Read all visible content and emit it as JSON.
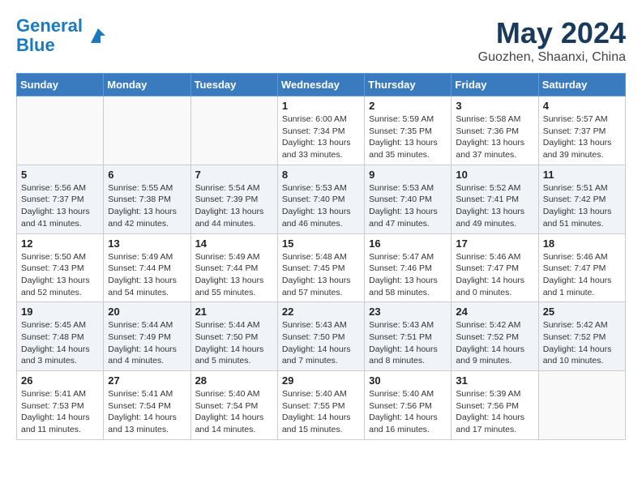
{
  "header": {
    "logo_line1": "General",
    "logo_line2": "Blue",
    "month": "May 2024",
    "location": "Guozhen, Shaanxi, China"
  },
  "weekdays": [
    "Sunday",
    "Monday",
    "Tuesday",
    "Wednesday",
    "Thursday",
    "Friday",
    "Saturday"
  ],
  "weeks": [
    [
      {
        "day": "",
        "info": ""
      },
      {
        "day": "",
        "info": ""
      },
      {
        "day": "",
        "info": ""
      },
      {
        "day": "1",
        "info": "Sunrise: 6:00 AM\nSunset: 7:34 PM\nDaylight: 13 hours\nand 33 minutes."
      },
      {
        "day": "2",
        "info": "Sunrise: 5:59 AM\nSunset: 7:35 PM\nDaylight: 13 hours\nand 35 minutes."
      },
      {
        "day": "3",
        "info": "Sunrise: 5:58 AM\nSunset: 7:36 PM\nDaylight: 13 hours\nand 37 minutes."
      },
      {
        "day": "4",
        "info": "Sunrise: 5:57 AM\nSunset: 7:37 PM\nDaylight: 13 hours\nand 39 minutes."
      }
    ],
    [
      {
        "day": "5",
        "info": "Sunrise: 5:56 AM\nSunset: 7:37 PM\nDaylight: 13 hours\nand 41 minutes."
      },
      {
        "day": "6",
        "info": "Sunrise: 5:55 AM\nSunset: 7:38 PM\nDaylight: 13 hours\nand 42 minutes."
      },
      {
        "day": "7",
        "info": "Sunrise: 5:54 AM\nSunset: 7:39 PM\nDaylight: 13 hours\nand 44 minutes."
      },
      {
        "day": "8",
        "info": "Sunrise: 5:53 AM\nSunset: 7:40 PM\nDaylight: 13 hours\nand 46 minutes."
      },
      {
        "day": "9",
        "info": "Sunrise: 5:53 AM\nSunset: 7:40 PM\nDaylight: 13 hours\nand 47 minutes."
      },
      {
        "day": "10",
        "info": "Sunrise: 5:52 AM\nSunset: 7:41 PM\nDaylight: 13 hours\nand 49 minutes."
      },
      {
        "day": "11",
        "info": "Sunrise: 5:51 AM\nSunset: 7:42 PM\nDaylight: 13 hours\nand 51 minutes."
      }
    ],
    [
      {
        "day": "12",
        "info": "Sunrise: 5:50 AM\nSunset: 7:43 PM\nDaylight: 13 hours\nand 52 minutes."
      },
      {
        "day": "13",
        "info": "Sunrise: 5:49 AM\nSunset: 7:44 PM\nDaylight: 13 hours\nand 54 minutes."
      },
      {
        "day": "14",
        "info": "Sunrise: 5:49 AM\nSunset: 7:44 PM\nDaylight: 13 hours\nand 55 minutes."
      },
      {
        "day": "15",
        "info": "Sunrise: 5:48 AM\nSunset: 7:45 PM\nDaylight: 13 hours\nand 57 minutes."
      },
      {
        "day": "16",
        "info": "Sunrise: 5:47 AM\nSunset: 7:46 PM\nDaylight: 13 hours\nand 58 minutes."
      },
      {
        "day": "17",
        "info": "Sunrise: 5:46 AM\nSunset: 7:47 PM\nDaylight: 14 hours\nand 0 minutes."
      },
      {
        "day": "18",
        "info": "Sunrise: 5:46 AM\nSunset: 7:47 PM\nDaylight: 14 hours\nand 1 minute."
      }
    ],
    [
      {
        "day": "19",
        "info": "Sunrise: 5:45 AM\nSunset: 7:48 PM\nDaylight: 14 hours\nand 3 minutes."
      },
      {
        "day": "20",
        "info": "Sunrise: 5:44 AM\nSunset: 7:49 PM\nDaylight: 14 hours\nand 4 minutes."
      },
      {
        "day": "21",
        "info": "Sunrise: 5:44 AM\nSunset: 7:50 PM\nDaylight: 14 hours\nand 5 minutes."
      },
      {
        "day": "22",
        "info": "Sunrise: 5:43 AM\nSunset: 7:50 PM\nDaylight: 14 hours\nand 7 minutes."
      },
      {
        "day": "23",
        "info": "Sunrise: 5:43 AM\nSunset: 7:51 PM\nDaylight: 14 hours\nand 8 minutes."
      },
      {
        "day": "24",
        "info": "Sunrise: 5:42 AM\nSunset: 7:52 PM\nDaylight: 14 hours\nand 9 minutes."
      },
      {
        "day": "25",
        "info": "Sunrise: 5:42 AM\nSunset: 7:52 PM\nDaylight: 14 hours\nand 10 minutes."
      }
    ],
    [
      {
        "day": "26",
        "info": "Sunrise: 5:41 AM\nSunset: 7:53 PM\nDaylight: 14 hours\nand 11 minutes."
      },
      {
        "day": "27",
        "info": "Sunrise: 5:41 AM\nSunset: 7:54 PM\nDaylight: 14 hours\nand 13 minutes."
      },
      {
        "day": "28",
        "info": "Sunrise: 5:40 AM\nSunset: 7:54 PM\nDaylight: 14 hours\nand 14 minutes."
      },
      {
        "day": "29",
        "info": "Sunrise: 5:40 AM\nSunset: 7:55 PM\nDaylight: 14 hours\nand 15 minutes."
      },
      {
        "day": "30",
        "info": "Sunrise: 5:40 AM\nSunset: 7:56 PM\nDaylight: 14 hours\nand 16 minutes."
      },
      {
        "day": "31",
        "info": "Sunrise: 5:39 AM\nSunset: 7:56 PM\nDaylight: 14 hours\nand 17 minutes."
      },
      {
        "day": "",
        "info": ""
      }
    ]
  ]
}
